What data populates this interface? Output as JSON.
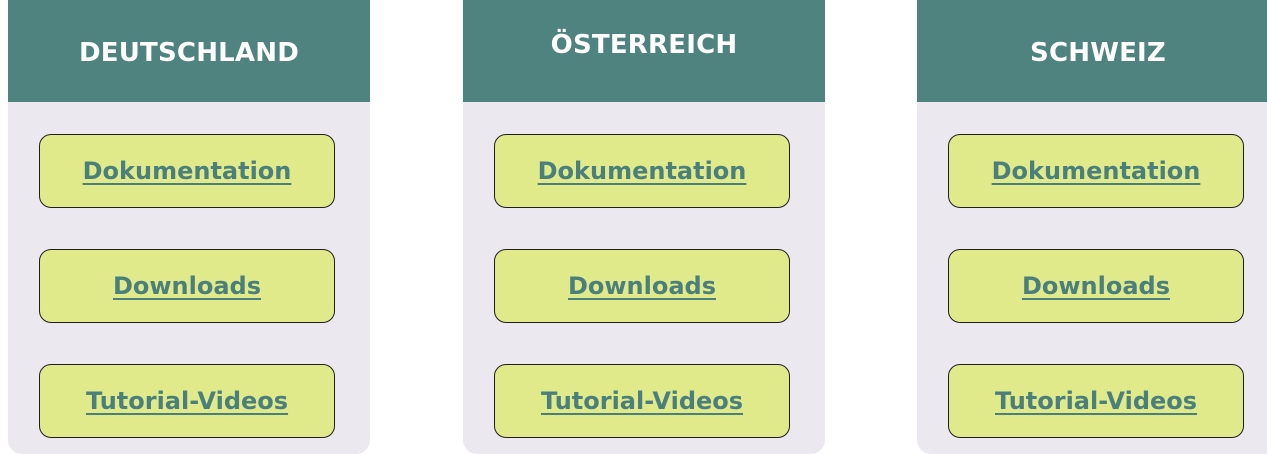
{
  "columns": [
    {
      "title": "DEUTSCHLAND",
      "links": [
        "Dokumentation",
        "Downloads",
        "Tutorial-Videos"
      ]
    },
    {
      "title": "ÖSTERREICH",
      "links": [
        "Dokumentation",
        "Downloads",
        "Tutorial-Videos"
      ]
    },
    {
      "title": "SCHWEIZ",
      "links": [
        "Dokumentation",
        "Downloads",
        "Tutorial-Videos"
      ]
    }
  ],
  "colors": {
    "header_bg": "#4e8380",
    "card_bg": "#ebe9ef",
    "button_bg": "#e0ea8a",
    "link_text": "#4a7f7c"
  }
}
